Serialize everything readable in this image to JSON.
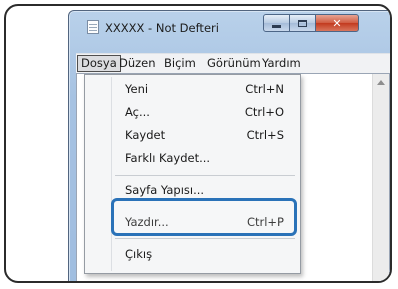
{
  "window": {
    "title": "XXXXX - Not Defteri"
  },
  "menubar": {
    "items": [
      "Dosya",
      "Düzen",
      "Biçim",
      "Görünüm",
      "Yardım"
    ]
  },
  "file_menu": {
    "items": [
      {
        "label": "Yeni",
        "shortcut": "Ctrl+N"
      },
      {
        "label": "Aç...",
        "shortcut": "Ctrl+O"
      },
      {
        "label": "Kaydet",
        "shortcut": "Ctrl+S"
      },
      {
        "label": "Farklı Kaydet...",
        "shortcut": ""
      },
      {
        "label": "Sayfa Yapısı...",
        "shortcut": ""
      },
      {
        "label": "Yazdır...",
        "shortcut": "Ctrl+P"
      },
      {
        "label": "Çıkış",
        "shortcut": ""
      }
    ]
  },
  "colors": {
    "highlight_border": "#2a72b8",
    "close_button": "#c23a1e"
  }
}
